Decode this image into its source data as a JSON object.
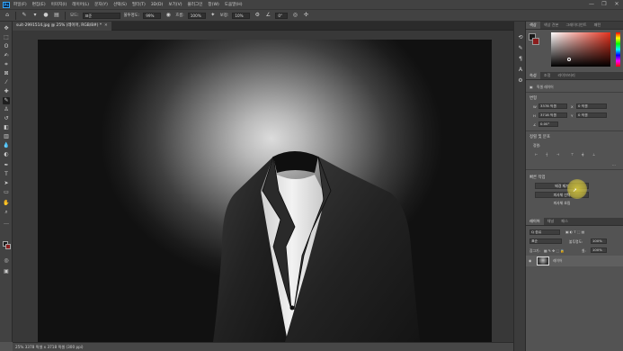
{
  "menubar": {
    "items": [
      "파일(F)",
      "편집(E)",
      "이미지(I)",
      "레이어(L)",
      "문자(Y)",
      "선택(S)",
      "필터(T)",
      "3D(D)",
      "보기(V)",
      "플러그인",
      "창(W)",
      "도움말(H)"
    ],
    "minimize": "—",
    "maximize": "❐",
    "close": "✕"
  },
  "options": {
    "mode_label": "모드:",
    "mode_value": "표준",
    "opacity_label": "불투명도:",
    "opacity_value": "99%",
    "flow_label": "흐름:",
    "flow_value": "100%",
    "smoothing_label": "보정:",
    "smoothing_value": "10%",
    "angle_value": "0°"
  },
  "document": {
    "tab_title": "suit-2991514.jpg @ 25% (레이어, RGB/8#) *",
    "status": "25%     3378 픽셀 x 3718 픽셀 (300 ppi)"
  },
  "panels": {
    "color_tabs": [
      "색상",
      "색상 견본",
      "그레이디언트",
      "패턴"
    ],
    "props_tabs": [
      "속성",
      "조정",
      "라이브러리"
    ],
    "props": {
      "layer_kind": "픽셀 레이어",
      "transform_title": "변형",
      "w_label": "W",
      "w_value": "3378 픽셀",
      "x_label": "X",
      "x_value": "0 픽셀",
      "h_label": "H",
      "h_value": "3718 픽셀",
      "y_label": "Y",
      "y_value": "0 픽셀",
      "angle_value": "0.00°",
      "align_title": "정렬 및 분포",
      "align_label": "정렬:",
      "quick_actions_title": "빠른 작업",
      "quick_action_1": "배경 제거",
      "quick_action_2": "피사체 선택",
      "quick_action_3": "피사체 흐림"
    },
    "layers_tabs": [
      "레이어",
      "채널",
      "패스"
    ],
    "layers": {
      "kind_label": "Q 종류",
      "blend_value": "표준",
      "opacity_label": "불투명도:",
      "opacity_value": "100%",
      "lock_label": "잠그기:",
      "fill_label": "칠:",
      "fill_value": "100%",
      "layer_name": "레이어"
    }
  },
  "colors": {
    "ui_dark": "#424242",
    "ui_panel": "#535353",
    "accent_cursor": "#e2d23c",
    "foreground_swatch": "#1a1a1a",
    "background_swatch": "#8b1d1d"
  }
}
